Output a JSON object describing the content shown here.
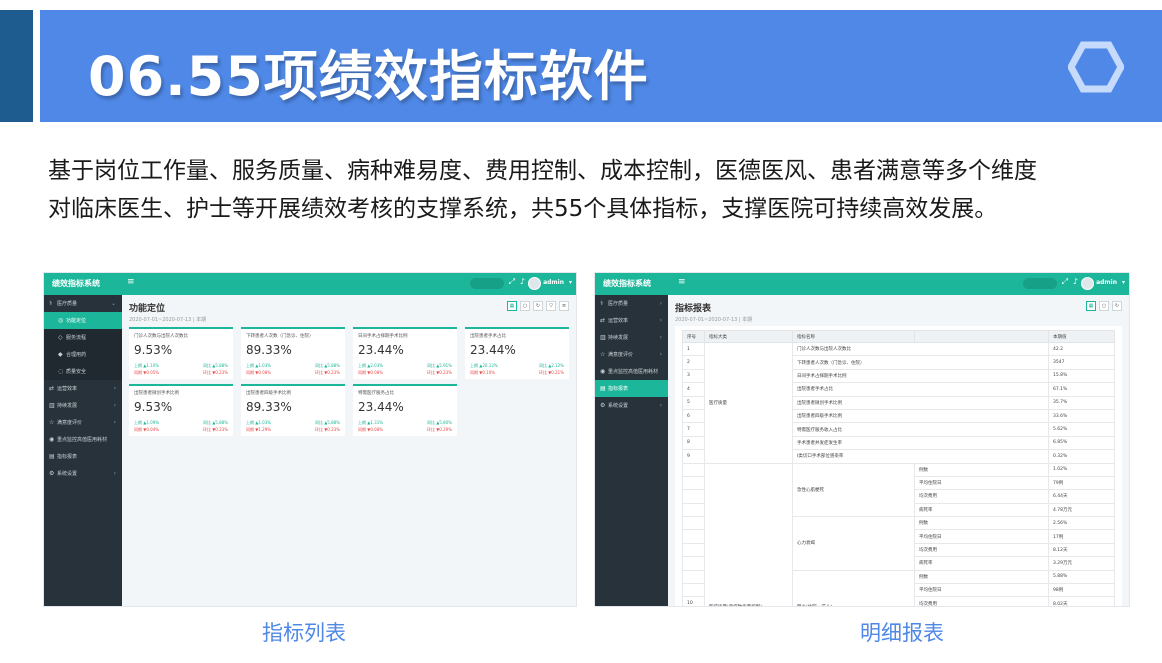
{
  "slide": {
    "title": "06.55项绩效指标软件",
    "intro_line1": "基于岗位工作量、服务质量、病种难易度、费用控制、成本控制，医德医风、患者满意等多个维度",
    "intro_line2": "对临床医生、护士等开展绩效考核的支撑系统，共55个具体指标，支撑医院可持续高效发展。",
    "caption_left": "指标列表",
    "caption_right": "明细报表",
    "colors": {
      "banner": "#4f88e6",
      "left_bar": "#1e5b8f",
      "topbar": "#1cb79a",
      "sidebar": "#28323a",
      "up": "#1cb79a",
      "down": "#e84a4a"
    }
  },
  "app": {
    "name": "绩效指标系统",
    "menu_icon": "≡",
    "user": "admin",
    "icons": [
      "search-icon",
      "expand-icon",
      "bell-icon",
      "avatar",
      "caret-down-icon"
    ]
  },
  "screen_a": {
    "sidebar": [
      {
        "label": "医疗质量",
        "arrow": "⌄"
      },
      {
        "label": "功能定位"
      },
      {
        "label": "服务流程"
      },
      {
        "label": "合理用药"
      },
      {
        "label": "质量安全"
      },
      {
        "label": "运营效率",
        "arrow": "›"
      },
      {
        "label": "持续发展",
        "arrow": "›"
      },
      {
        "label": "满意度评价",
        "arrow": "›"
      },
      {
        "label": "重点监控高值医用耗材"
      },
      {
        "label": "指标报表"
      },
      {
        "label": "系统设置",
        "arrow": "›"
      }
    ],
    "page_title": "功能定位",
    "page_date": "2020-07-01~2020-07-13 | 本期",
    "cards": [
      {
        "label": "门诊人次数与出院人次数比",
        "value": "9.53%",
        "r1a": "上期 ▲1.10%",
        "r1b": "同比 ▲5.88%",
        "r2a": "同期 ▼0.05%",
        "r2b": "环比 ▼0.23%"
      },
      {
        "label": "下转患者人次数（门急诊、住院）",
        "value": "89.33%",
        "r1a": "上期 ▲1.03%",
        "r1b": "同比 ▲5.88%",
        "r2a": "同期 ▼0.08%",
        "r2b": "环比 ▼0.23%"
      },
      {
        "label": "日间手术占择期手术比例",
        "value": "23.44%",
        "r1a": "上期 ▲2.03%",
        "r1b": "同比 ▲5.91%",
        "r2a": "同期 ▼0.08%",
        "r2b": "环比 ▼0.23%"
      },
      {
        "label": "出院患者手术占比",
        "value": "23.44%",
        "r1a": "上期 ▲20.13%",
        "r1b": "同比 ▲2.12%",
        "r2a": "同期 ▼0.10%",
        "r2b": "环比 ▼0.21%"
      },
      {
        "label": "出院患者微创手术比例",
        "value": "9.53%",
        "r1a": "上期 ▲1.09%",
        "r1b": "同比 ▲5.88%",
        "r2a": "同期 ▼0.04%",
        "r2b": "环比 ▼0.23%"
      },
      {
        "label": "出院患者四级手术比例",
        "value": "89.33%",
        "r1a": "上期 ▲1.03%",
        "r1b": "同比 ▲5.88%",
        "r2a": "同期 ▼1.29%",
        "r2b": "环比 ▼0.23%"
      },
      {
        "label": "特需医疗服务占比",
        "value": "23.44%",
        "r1a": "上期 ▲1.31%",
        "r1b": "同比 ▲5.80%",
        "r2a": "同期 ▼0.08%",
        "r2b": "环比 ▼0.29%"
      }
    ]
  },
  "screen_b": {
    "sidebar": [
      {
        "label": "医疗质量",
        "arrow": "›"
      },
      {
        "label": "运营效率",
        "arrow": "›"
      },
      {
        "label": "持续发展",
        "arrow": "›"
      },
      {
        "label": "满意度评价",
        "arrow": "›"
      },
      {
        "label": "重点监控高值医用耗材"
      },
      {
        "label": "指标报表"
      },
      {
        "label": "系统设置",
        "arrow": "›"
      }
    ],
    "page_title": "指标报表",
    "page_date": "2020-07-01~2020-07-13 | 本期",
    "headers": [
      "序号",
      "指标大类",
      "指标名称",
      "",
      "本期值"
    ],
    "rows": [
      {
        "no": "1",
        "name": "门诊人次数与出院人次数比",
        "sub": "",
        "value": "42.2"
      },
      {
        "no": "2",
        "name": "下转患者人次数（门急诊、住院）",
        "sub": "",
        "value": "3547"
      },
      {
        "no": "3",
        "name": "日间手术占择期手术比例",
        "sub": "",
        "value": "15.8%"
      },
      {
        "no": "4",
        "name": "出院患者手术占比",
        "sub": "",
        "value": "67.1%"
      },
      {
        "no": "5",
        "name": "出院患者微创手术比例",
        "sub": "",
        "value": "35.7%"
      },
      {
        "no": "6",
        "name": "出院患者四级手术比例",
        "sub": "",
        "value": "33.6%"
      },
      {
        "no": "7",
        "name": "特需医疗服务收入占比",
        "sub": "",
        "value": "5.62%"
      },
      {
        "no": "8",
        "name": "手术患者并发症发生率",
        "sub": "",
        "value": "6.85%"
      },
      {
        "no": "9",
        "name": "I类切口手术部位感染率",
        "sub": "",
        "value": "0.32%"
      },
      {
        "no": "",
        "name": "",
        "sub": "例数",
        "value": "1.02%"
      },
      {
        "no": "",
        "name": "",
        "sub": "平均住院日",
        "value": "79例"
      },
      {
        "no": "",
        "name": "",
        "sub": "均次费用",
        "value": "6.44天"
      },
      {
        "no": "",
        "name": "",
        "sub": "病死率",
        "value": "4.78万元"
      },
      {
        "no": "",
        "name": "",
        "sub": "例数",
        "value": "2.56%"
      },
      {
        "no": "",
        "name": "",
        "sub": "平均住院日",
        "value": "17例"
      },
      {
        "no": "",
        "name": "",
        "sub": "均次费用",
        "value": "8.12天"
      },
      {
        "no": "",
        "name": "",
        "sub": "病死率",
        "value": "3.29万元"
      },
      {
        "no": "",
        "name": "",
        "sub": "例数",
        "value": "5.88%"
      },
      {
        "no": "",
        "name": "",
        "sub": "平均住院日",
        "value": "98例"
      },
      {
        "no": "10",
        "name": "",
        "sub": "均次费用",
        "value": "8.02天"
      }
    ],
    "group1": "医疗质量",
    "group10": "医疗质量(单病种质量控制)",
    "sub_groups": [
      "急性心肌梗死",
      "心力衰竭",
      "肺炎(住院、成人)"
    ]
  }
}
